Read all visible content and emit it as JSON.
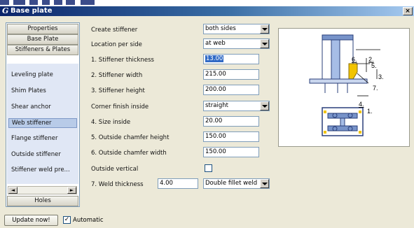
{
  "window": {
    "title": "Base plate",
    "logo": "G",
    "close": "×"
  },
  "nav": {
    "groups": [
      "Properties",
      "Base Plate",
      "Stiffeners & Plates"
    ],
    "items": [
      "Leveling plate",
      "Shim Plates",
      "Shear anchor",
      "Web stiffener",
      "Flange stiffener",
      "Outside stiffener",
      "Stiffener weld pre..."
    ],
    "bottom": "Holes",
    "scroll_left": "◄",
    "scroll_right": "►"
  },
  "form": {
    "create_stiffener": {
      "label": "Create stiffener",
      "value": "both sides"
    },
    "location_per_side": {
      "label": "Location per side",
      "value": "at web"
    },
    "stiffener_thickness": {
      "label": "1. Stiffener thickness",
      "value": "13.00"
    },
    "stiffener_width": {
      "label": "2. Stiffener width",
      "value": "215.00"
    },
    "stiffener_height": {
      "label": "3. Stiffener height",
      "value": "200.00"
    },
    "corner_finish": {
      "label": "Corner finish inside",
      "value": "straight"
    },
    "size_inside": {
      "label": "4. Size inside",
      "value": "20.00"
    },
    "chamfer_height": {
      "label": "5. Outside chamfer height",
      "value": "150.00"
    },
    "chamfer_width": {
      "label": "6. Outside chamfer width",
      "value": "150.00"
    },
    "outside_vertical": {
      "label": "Outside vertical",
      "checked": false
    },
    "weld_thickness": {
      "label": "7. Weld thickness",
      "value": "4.00",
      "type": "Double fillet weld"
    }
  },
  "drawing": {
    "labels": [
      "1.",
      "2.",
      "3.",
      "4.",
      "5.",
      "6.",
      "7."
    ]
  },
  "footer": {
    "update_label": "Update now!",
    "automatic_label": "Automatic",
    "automatic_checked": true,
    "check_mark": "✓"
  },
  "colors": {
    "title_start": "#0a246a",
    "title_end": "#a6caf0",
    "selection": "#316ac5",
    "nav_bg": "#e0e7f5",
    "weld": "#f2c400"
  }
}
